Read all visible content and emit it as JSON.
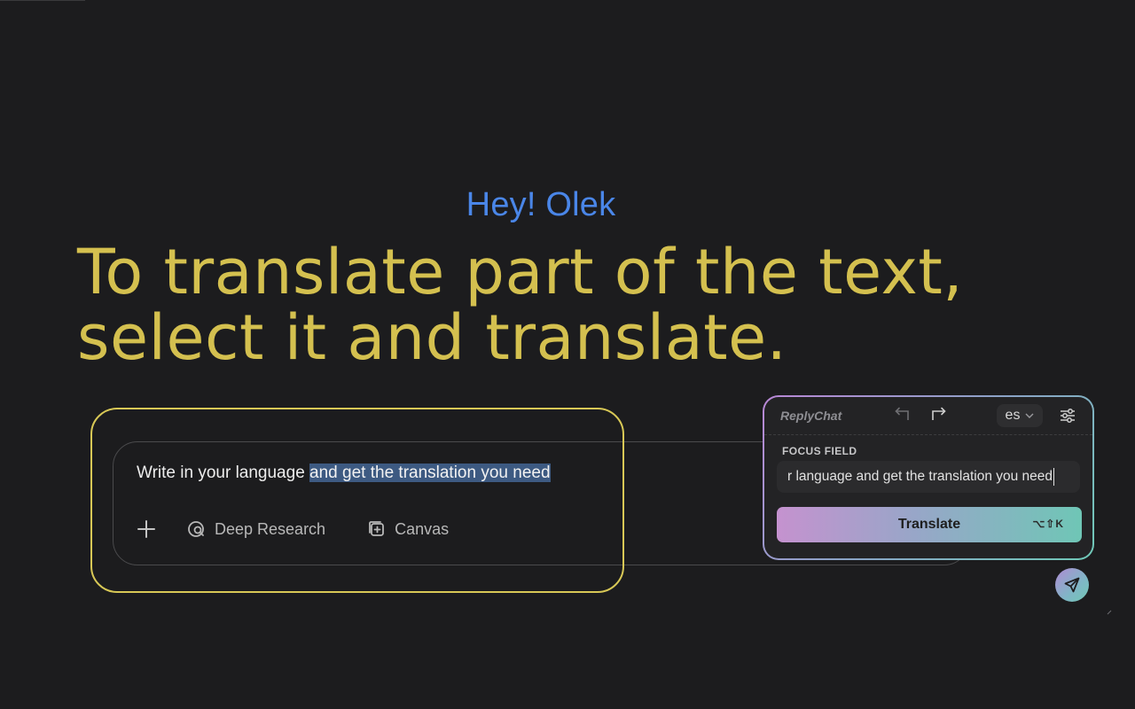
{
  "page": {
    "greeting": "Hey! Olek",
    "headline_line1": "To translate part of the text,",
    "headline_line2": "select it and translate."
  },
  "chat": {
    "text_plain": "Write in your language ",
    "text_selected": "and get the translation you need",
    "tools": [
      {
        "label": "",
        "icon": "plus-icon"
      },
      {
        "label": "Deep Research",
        "icon": "deep-research-icon"
      },
      {
        "label": "Canvas",
        "icon": "canvas-icon"
      }
    ]
  },
  "reply_popup": {
    "brand": "ReplyChat",
    "language": "es",
    "focus_label": "FOCUS FIELD",
    "focus_value": "r language and get the translation you need",
    "translate_label": "Translate",
    "shortcut": "⌥⇧K",
    "icons": [
      "undo-icon",
      "redo-icon",
      "chevron-down-icon",
      "settings-sliders-icon",
      "send-icon"
    ]
  },
  "colors": {
    "background": "#1c1c1e",
    "greeting": "#4a86e8",
    "headline": "#d4c04f",
    "highlight_frame": "#d8c856",
    "selection": "#3d5a82",
    "gradient_start": "#c592cf",
    "gradient_end": "#6fc6b6"
  }
}
